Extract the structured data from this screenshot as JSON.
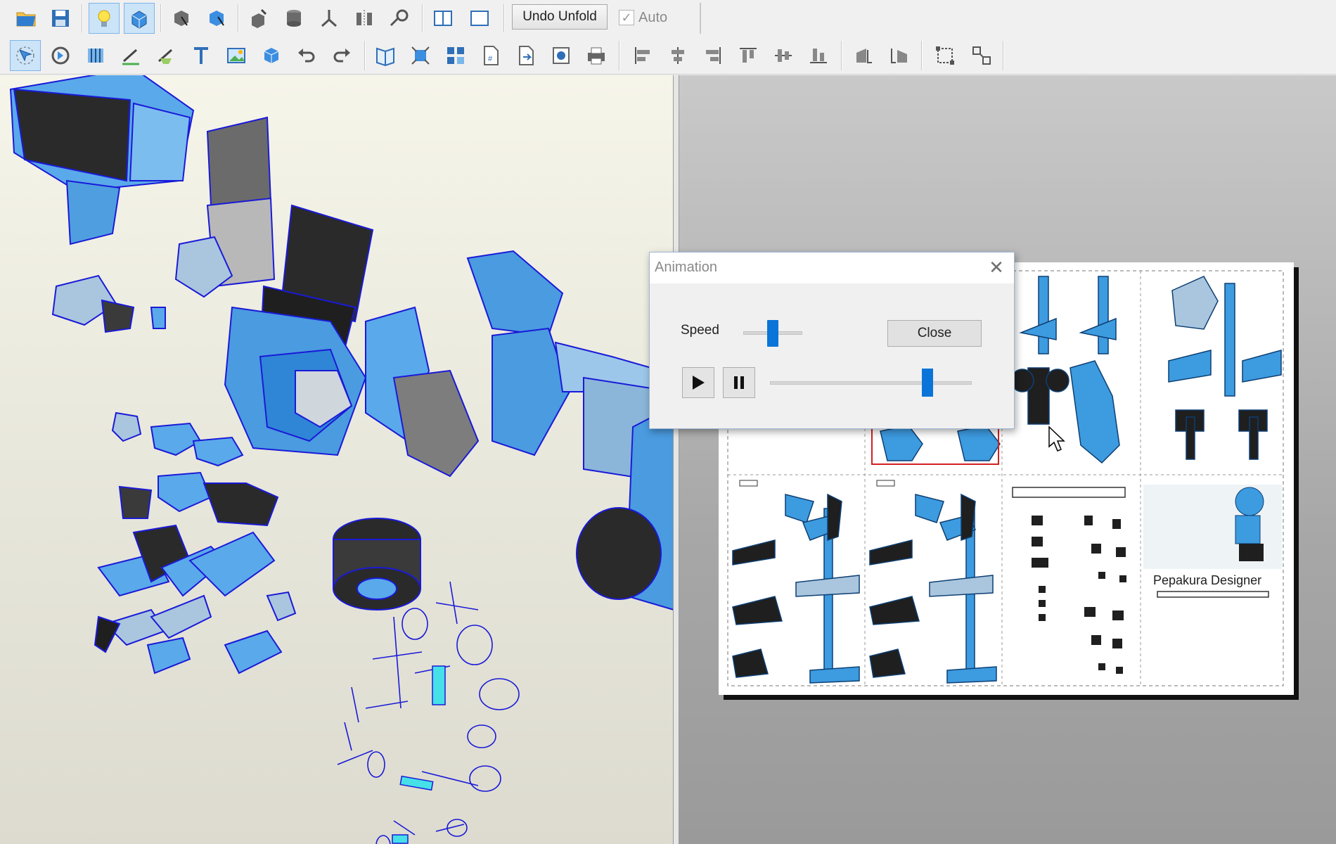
{
  "toolbar_top": {
    "undo_unfold_label": "Undo Unfold",
    "auto_label": "Auto",
    "auto_checked": true,
    "icons": [
      "open-folder-icon",
      "save-icon",
      "light-bulb-icon",
      "3d-view-icon",
      "select-faces-icon",
      "select-parts-icon",
      "paint-icon",
      "cylinder-icon",
      "axes-icon",
      "mirror-icon",
      "link-icon",
      "split-view-icon",
      "single-view-icon"
    ]
  },
  "toolbar_bottom": {
    "icons": [
      "move-part-icon",
      "rotate-part-icon",
      "join-edges-icon",
      "line-tool-icon",
      "flap-tool-icon",
      "text-tool-icon",
      "image-tool-icon",
      "box-icon",
      "undo-icon",
      "redo-icon",
      "unfold-book-icon",
      "fit-icon",
      "grid-layout-icon",
      "page-number-icon",
      "next-page-icon",
      "camera-icon",
      "print-icon",
      "align-left-icon",
      "align-center-icon",
      "align-right-icon",
      "align-top-icon",
      "align-middle-icon",
      "align-bottom-icon",
      "flip-h-icon",
      "flip-v-icon",
      "group-icon",
      "ungroup-icon"
    ]
  },
  "dialog": {
    "title": "Animation",
    "speed_label": "Speed",
    "close_label": "Close",
    "speed_level": 0.5,
    "frame_level": 0.78
  },
  "pattern_sheet": {
    "watermark": "Pepakura Designer"
  },
  "colors": {
    "accent_blue": "#0a74d8",
    "part_blue": "#3d9be0",
    "edge_blue": "#1a1ad8"
  }
}
